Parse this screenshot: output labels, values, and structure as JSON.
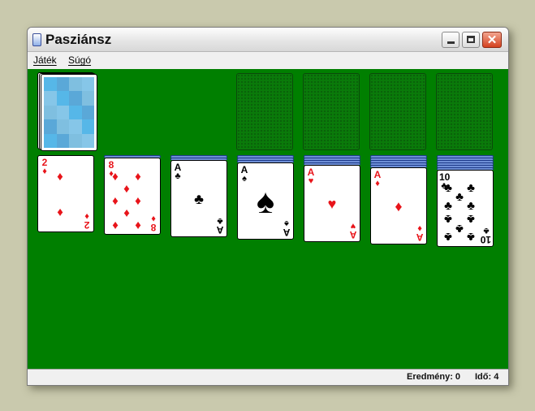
{
  "window": {
    "title": "Pasziánsz"
  },
  "menu": [
    {
      "label": "Játék"
    },
    {
      "label": "Súgó"
    }
  ],
  "colors": {
    "felt": "#007f00",
    "red_suit": "#e8141a",
    "back_colors": [
      "#56b7e8",
      "#86c6e8",
      "#7fbfe0",
      "#5aa8d8"
    ]
  },
  "stock": {
    "card_back": "blue-pixel-pattern"
  },
  "foundations": 4,
  "tableau": [
    {
      "face_down": 0,
      "rank": "2",
      "suit": "diamonds",
      "suit_glyph": "♦",
      "color": "red"
    },
    {
      "face_down": 1,
      "rank": "8",
      "suit": "diamonds",
      "suit_glyph": "♦",
      "color": "red"
    },
    {
      "face_down": 2,
      "rank": "A",
      "suit": "clubs",
      "suit_glyph": "♣",
      "color": "black"
    },
    {
      "face_down": 3,
      "rank": "A",
      "suit": "spades",
      "suit_glyph": "♠",
      "color": "black"
    },
    {
      "face_down": 4,
      "rank": "A",
      "suit": "hearts",
      "suit_glyph": "♥",
      "color": "red"
    },
    {
      "face_down": 5,
      "rank": "A",
      "suit": "diamonds",
      "suit_glyph": "♦",
      "color": "red"
    },
    {
      "face_down": 6,
      "rank": "10",
      "suit": "clubs",
      "suit_glyph": "♣",
      "color": "black"
    }
  ],
  "status": {
    "score": "Eredmény: 0",
    "time": "Idő: 4"
  }
}
